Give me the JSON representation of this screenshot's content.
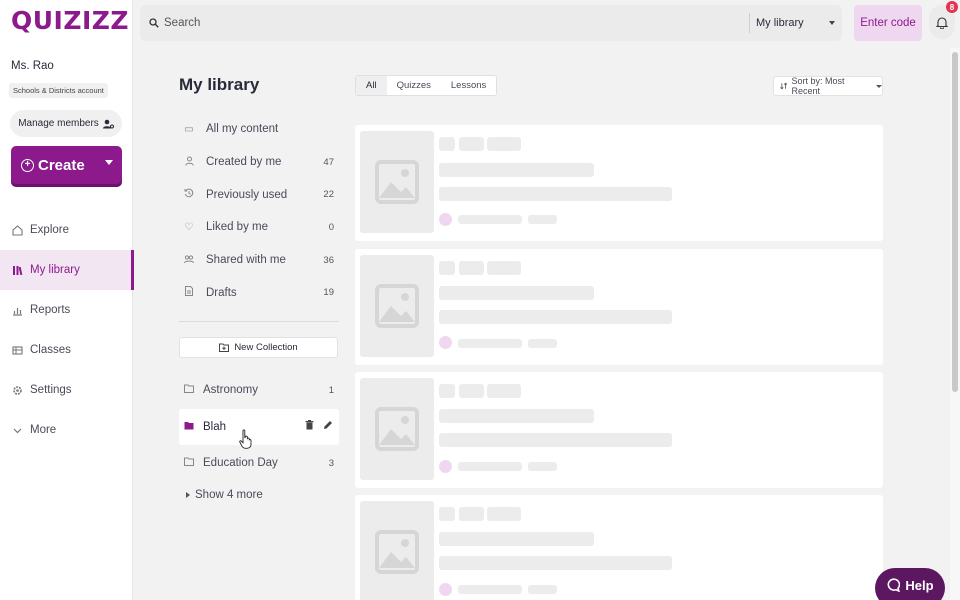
{
  "brand": {
    "logo_text": "QUIZIZZ",
    "accent": "#8d1a8d"
  },
  "user": {
    "name": "Ms. Rao",
    "account_type": "Schools & Districts account"
  },
  "sidebar": {
    "manage_members": "Manage members",
    "create_label": "Create",
    "nav": [
      {
        "label": "Explore",
        "icon": "compass-icon"
      },
      {
        "label": "My library",
        "icon": "library-icon",
        "active": true
      },
      {
        "label": "Reports",
        "icon": "reports-icon"
      },
      {
        "label": "Classes",
        "icon": "classes-icon"
      },
      {
        "label": "Settings",
        "icon": "gear-icon"
      },
      {
        "label": "More",
        "icon": "chevron-down-icon"
      }
    ]
  },
  "topbar": {
    "search_placeholder": "Search",
    "scope": "My library",
    "enter_code": "Enter code",
    "notification_count": "8"
  },
  "library": {
    "title": "My library",
    "items": [
      {
        "label": "All my content",
        "count": ""
      },
      {
        "label": "Created by me",
        "count": "47"
      },
      {
        "label": "Previously used",
        "count": "22"
      },
      {
        "label": "Liked by me",
        "count": "0"
      },
      {
        "label": "Shared with me",
        "count": "36"
      },
      {
        "label": "Drafts",
        "count": "19"
      }
    ],
    "new_collection": "New Collection",
    "collections": [
      {
        "label": "Astronomy",
        "count": "1"
      },
      {
        "label": "Blah",
        "count": ""
      },
      {
        "label": "Education Day",
        "count": "3"
      }
    ],
    "show_more": "Show 4 more"
  },
  "filters": {
    "tabs": [
      "All",
      "Quizzes",
      "Lessons"
    ],
    "active": "All",
    "sort": "Sort by: Most Recent"
  },
  "help_label": "Help"
}
